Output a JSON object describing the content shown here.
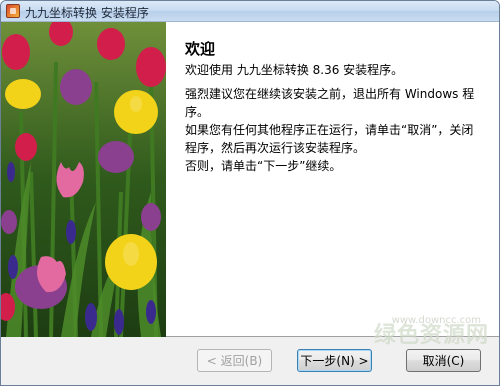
{
  "window": {
    "title": "九九坐标转换 安装程序"
  },
  "page": {
    "heading": "欢迎",
    "paragraphs": [
      "欢迎使用 九九坐标转换 8.36 安装程序。",
      "强烈建议您在继续该安装之前，退出所有 Windows 程序。",
      "如果您有任何其他程序正在运行，请单击“取消”，关闭程序，然后再次运行该安装程序。",
      "否则，请单击“下一步”继续。"
    ]
  },
  "buttons": {
    "back": "< 返回(B)",
    "next": "下一步(N) >",
    "cancel": "取消(C)"
  },
  "watermark": {
    "text": "绿色资源网",
    "url": "www.downcc.com"
  },
  "image": {
    "subject": "tulip-garden-photo",
    "colors": [
      "#d21e4b",
      "#f3d21a",
      "#8a3f8f",
      "#e36aa0",
      "#3b2a8e",
      "#2f6b1f"
    ]
  }
}
